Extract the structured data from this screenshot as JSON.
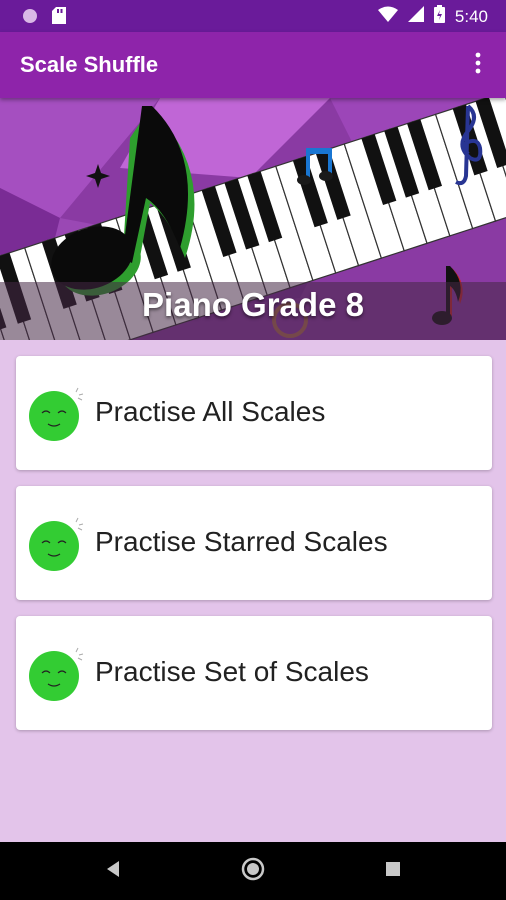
{
  "status_bar": {
    "time": "5:40",
    "icons": [
      "notification-dot-icon",
      "sd-card-icon",
      "wifi-icon",
      "cell-signal-icon",
      "battery-icon"
    ]
  },
  "app_bar": {
    "title": "Scale Shuffle",
    "overflow_icon": "more-vert-icon"
  },
  "banner": {
    "title": "Piano Grade 8"
  },
  "menu": {
    "items": [
      {
        "label": "Practise All Scales",
        "icon": "smiley-face-icon"
      },
      {
        "label": "Practise Starred Scales",
        "icon": "smiley-face-icon"
      },
      {
        "label": "Practise Set of Scales",
        "icon": "smiley-face-icon"
      }
    ]
  },
  "colors": {
    "status_bar": "#6a1b9a",
    "app_bar": "#8e24aa",
    "background": "#e3c4ea",
    "smiley": "#33cc33"
  },
  "nav_bar": {
    "icons": [
      "back-icon",
      "home-icon",
      "recents-icon"
    ]
  }
}
